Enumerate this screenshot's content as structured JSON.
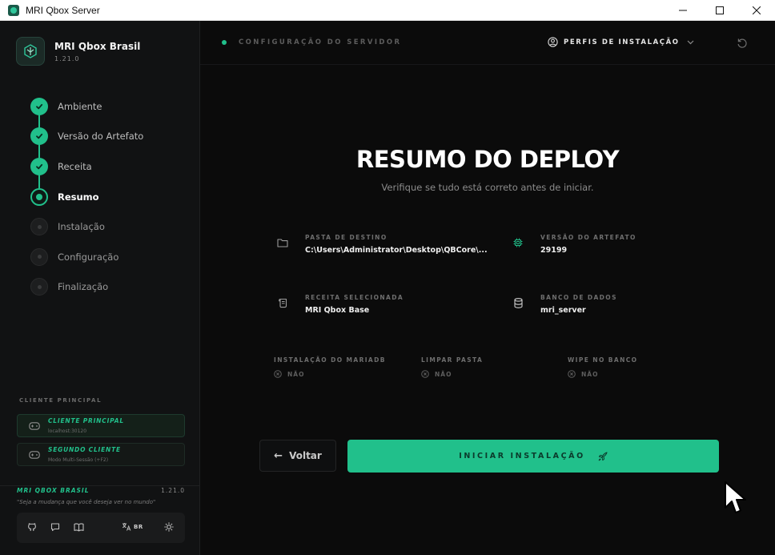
{
  "window": {
    "title": "MRI Qbox Server"
  },
  "sidebar": {
    "brand_name": "MRI Qbox Brasil",
    "brand_version": "1.21.0",
    "steps": [
      {
        "label": "Ambiente",
        "state": "done"
      },
      {
        "label": "Versão do Artefato",
        "state": "done"
      },
      {
        "label": "Receita",
        "state": "done"
      },
      {
        "label": "Resumo",
        "state": "current"
      },
      {
        "label": "Instalação",
        "state": "pending"
      },
      {
        "label": "Configuração",
        "state": "pending"
      },
      {
        "label": "Finalização",
        "state": "pending"
      }
    ],
    "clients_title": "CLIENTE PRINCIPAL",
    "clients": [
      {
        "title": "CLIENTE PRINCIPAL",
        "subtitle": "localhost:30120"
      },
      {
        "title": "SEGUNDO CLIENTE",
        "subtitle": "Modo Multi-Sessão (+F2)"
      }
    ],
    "footer": {
      "brand": "MRI QBOX BRASIL",
      "version": "1.21.0",
      "quote": "\"Seja a mudança que você deseja ver no mundo\"",
      "language": "BR"
    }
  },
  "topbar": {
    "title": "CONFIGURAÇÃO DO SERVIDOR",
    "profiles_label": "PERFIS DE INSTALAÇÃO"
  },
  "summary": {
    "title": "RESUMO DO DEPLOY",
    "subtitle": "Verifique se tudo está correto antes de iniciar.",
    "destination_label": "PASTA DE DESTINO",
    "destination_value": "C:\\Users\\Administrator\\Desktop\\QBCore\\...",
    "artifact_label": "VERSÃO DO ARTEFATO",
    "artifact_value": "29199",
    "recipe_label": "RECEITA SELECIONADA",
    "recipe_value": "MRI Qbox Base",
    "database_label": "BANCO DE DADOS",
    "database_value": "mri_server",
    "options": [
      {
        "label": "INSTALAÇÃO DO MARIADB",
        "value": "NÃO"
      },
      {
        "label": "LIMPAR PASTA",
        "value": "NÃO"
      },
      {
        "label": "WIPE NO BANCO",
        "value": "NÃO"
      }
    ]
  },
  "actions": {
    "back_label": "Voltar",
    "start_label": "INICIAR INSTALAÇÃO"
  },
  "colors": {
    "accent": "#21c08b",
    "background": "#0b0b0b",
    "sidebar": "#111213"
  }
}
